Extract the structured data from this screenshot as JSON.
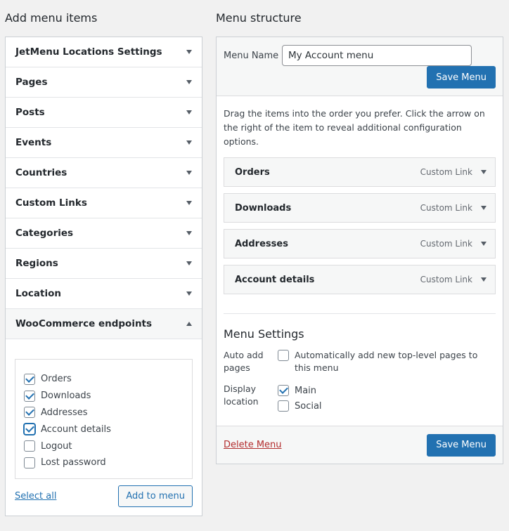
{
  "left": {
    "title": "Add menu items",
    "sections": [
      {
        "label": "JetMenu Locations Settings"
      },
      {
        "label": "Pages"
      },
      {
        "label": "Posts"
      },
      {
        "label": "Events"
      },
      {
        "label": "Countries"
      },
      {
        "label": "Custom Links"
      },
      {
        "label": "Categories"
      },
      {
        "label": "Regions"
      },
      {
        "label": "Location"
      },
      {
        "label": "WooCommerce endpoints"
      }
    ],
    "endpoints": [
      {
        "label": "Orders",
        "checked": true
      },
      {
        "label": "Downloads",
        "checked": true
      },
      {
        "label": "Addresses",
        "checked": true
      },
      {
        "label": "Account details",
        "checked": true
      },
      {
        "label": "Logout",
        "checked": false
      },
      {
        "label": "Lost password",
        "checked": false
      }
    ],
    "select_all": "Select all",
    "add_to_menu": "Add to menu"
  },
  "right": {
    "title": "Menu structure",
    "menu_name_label": "Menu Name",
    "menu_name_value": "My Account menu",
    "save_menu": "Save Menu",
    "instructions": "Drag the items into the order you prefer. Click the arrow on the right of the item to reveal additional configuration options.",
    "items": [
      {
        "title": "Orders",
        "type": "Custom Link"
      },
      {
        "title": "Downloads",
        "type": "Custom Link"
      },
      {
        "title": "Addresses",
        "type": "Custom Link"
      },
      {
        "title": "Account details",
        "type": "Custom Link"
      }
    ],
    "settings": {
      "title": "Menu Settings",
      "auto_add_label": "Auto add pages",
      "auto_add_text": "Automatically add new top-level pages to this menu",
      "display_location_label": "Display location",
      "locations": [
        {
          "label": "Main",
          "checked": true
        },
        {
          "label": "Social",
          "checked": false
        }
      ]
    },
    "delete_menu": "Delete Menu",
    "save_menu_bottom": "Save Menu"
  },
  "colors": {
    "accent": "#2271b1",
    "danger": "#b32d2e",
    "background": "#f1f1f1"
  }
}
